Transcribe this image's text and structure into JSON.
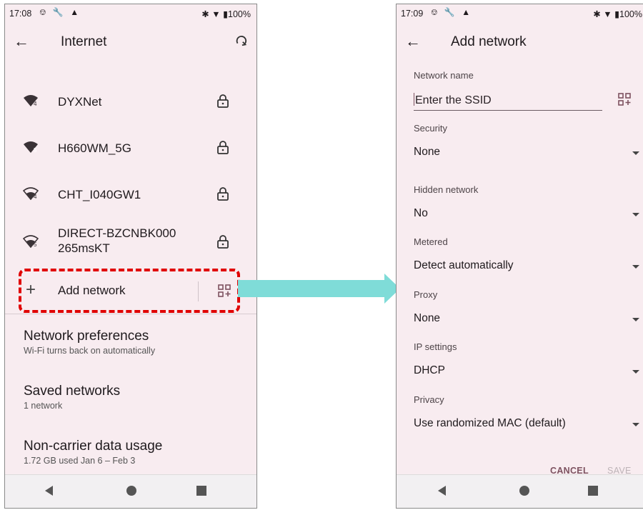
{
  "left": {
    "status": {
      "time": "17:08",
      "battery": "100%"
    },
    "title": "Internet",
    "networks": [
      {
        "name": "DYXNet",
        "wifi_icon": "wifi-4-icon"
      },
      {
        "name": "H660WM_5G",
        "wifi_icon": "wifi-5-icon"
      },
      {
        "name": "CHT_I040GW1",
        "wifi_icon": "wifi-4-icon"
      },
      {
        "name_line1": "DIRECT-BZCNBK000",
        "name_line2": "265msKT",
        "wifi_icon": "wifi-5-icon"
      }
    ],
    "add_network": "Add network",
    "preferences": [
      {
        "title": "Network preferences",
        "subtitle": "Wi-Fi turns back on automatically"
      },
      {
        "title": "Saved networks",
        "subtitle": "1 network"
      },
      {
        "title": "Non-carrier data usage",
        "subtitle": "1.72 GB used Jan 6 – Feb 3"
      }
    ]
  },
  "right": {
    "status": {
      "time": "17:09",
      "battery": "100%"
    },
    "title": "Add network",
    "network_name": {
      "label": "Network name",
      "placeholder": "Enter the SSID"
    },
    "fields": [
      {
        "label": "Security",
        "value": "None"
      },
      {
        "label": "Hidden network",
        "value": "No"
      },
      {
        "label": "Metered",
        "value": "Detect automatically"
      },
      {
        "label": "Proxy",
        "value": "None"
      },
      {
        "label": "IP settings",
        "value": "DHCP"
      },
      {
        "label": "Privacy",
        "value": "Use randomized MAC (default)"
      }
    ],
    "cancel": "CANCEL",
    "save": "SAVE"
  },
  "colors": {
    "background": "#f8ecf0",
    "accent": "#7d5260",
    "highlight": "#e00000",
    "arrow": "#7fdcd8"
  }
}
